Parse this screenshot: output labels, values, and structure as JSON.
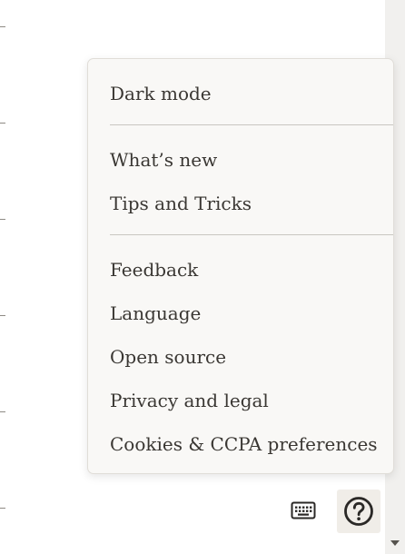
{
  "menu": {
    "items": [
      {
        "label": "Dark mode"
      },
      {
        "label": "What’s new"
      },
      {
        "label": "Tips and Tricks"
      },
      {
        "label": "Feedback"
      },
      {
        "label": "Language"
      },
      {
        "label": "Open source"
      },
      {
        "label": "Privacy and legal"
      },
      {
        "label": "Cookies & CCPA preferences"
      }
    ]
  },
  "toolbar": {
    "keyboard_icon": "keyboard-icon",
    "help_icon": "help-circle-icon"
  },
  "colors": {
    "menu_background": "#f9f8f6",
    "help_button_background": "#f0ede8",
    "text": "#3a3733"
  }
}
